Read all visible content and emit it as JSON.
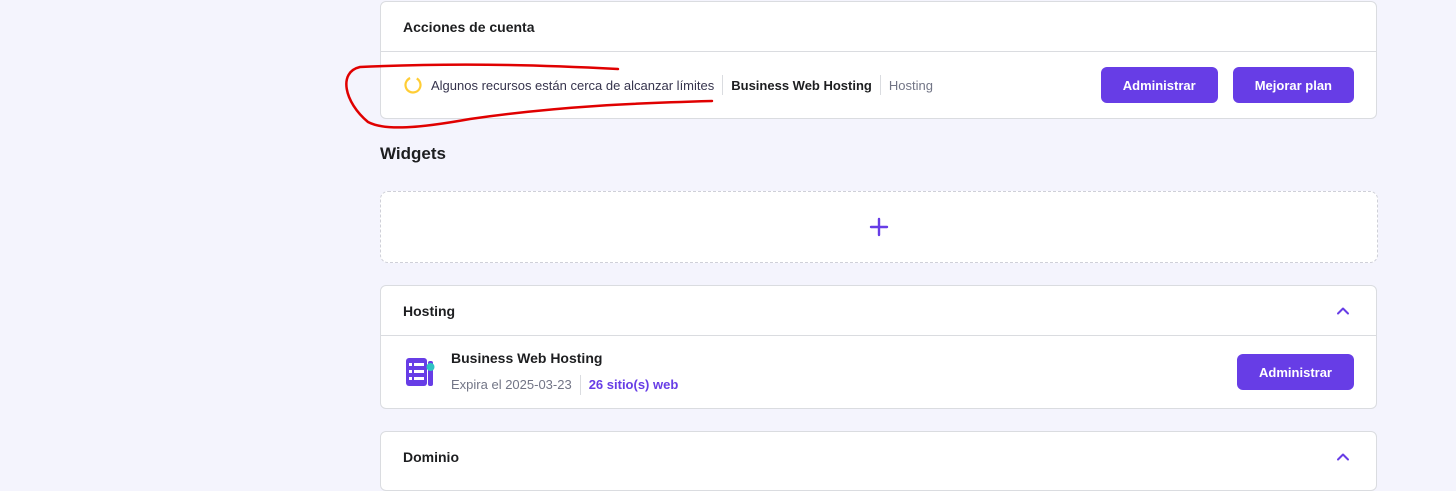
{
  "acciones": {
    "title": "Acciones de cuenta",
    "warning": "Algunos recursos están cerca de alcanzar límites",
    "plan_name": "Business Web Hosting",
    "plan_type": "Hosting",
    "administrar_label": "Administrar",
    "mejorar_label": "Mejorar plan"
  },
  "widgets": {
    "title": "Widgets",
    "add_icon": "plus-icon"
  },
  "hosting": {
    "title": "Hosting",
    "name": "Business Web Hosting",
    "expira": "Expira el 2025-03-23",
    "sites": "26 sitio(s) web",
    "administrar_label": "Administrar"
  },
  "dominio": {
    "title": "Dominio"
  },
  "colors": {
    "accent": "#673de6",
    "warning": "#ffcd35",
    "annotation": "#e00000",
    "background": "#f4f4fd"
  }
}
